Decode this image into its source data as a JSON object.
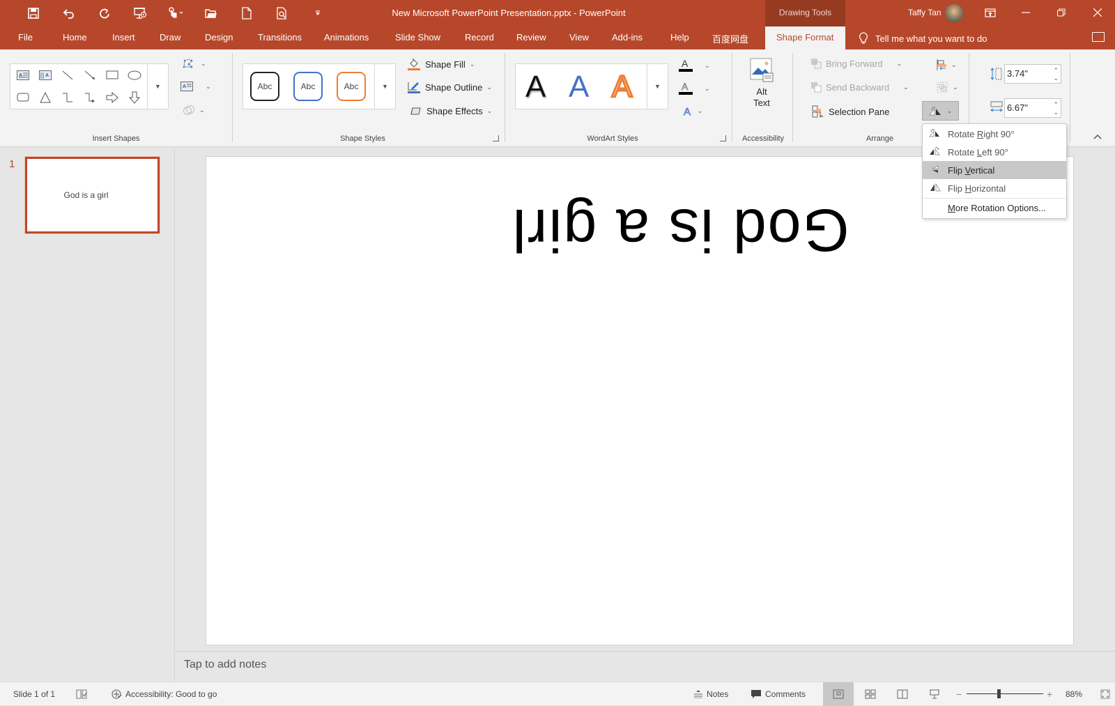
{
  "window": {
    "title": "New Microsoft PowerPoint Presentation.pptx  -  PowerPoint",
    "contextual_group": "Drawing Tools",
    "user_name": "Taffy Tan",
    "brand_color": "#b7472a"
  },
  "qat": [
    {
      "name": "save-icon",
      "glyph": "💾"
    },
    {
      "name": "undo-icon",
      "glyph": "↶"
    },
    {
      "name": "redo-icon",
      "glyph": "↻"
    },
    {
      "name": "present-from-beginning-icon",
      "glyph": "⎚"
    },
    {
      "name": "touch-mode-icon",
      "glyph": "☝"
    },
    {
      "name": "open-icon",
      "glyph": "📂"
    },
    {
      "name": "new-icon",
      "glyph": "🗋"
    },
    {
      "name": "print-preview-icon",
      "glyph": "🔍"
    },
    {
      "name": "customize-qat-icon",
      "glyph": "▾"
    }
  ],
  "tabs": [
    "File",
    "Home",
    "Insert",
    "Draw",
    "Design",
    "Transitions",
    "Animations",
    "Slide Show",
    "Record",
    "Review",
    "View",
    "Add-ins",
    "Help",
    "百度网盘",
    "Shape Format"
  ],
  "active_tab": "Shape Format",
  "tell_me": "Tell me what you want to do",
  "ribbon": {
    "groups": {
      "insert_shapes": "Insert Shapes",
      "shape_styles": "Shape Styles",
      "wordart_styles": "WordArt Styles",
      "accessibility": "Accessibility",
      "arrange": "Arrange"
    },
    "shape_style_presets": [
      "Abc",
      "Abc",
      "Abc"
    ],
    "wordart_presets": [
      "A",
      "A",
      "A"
    ],
    "shape_fill": "Shape Fill",
    "shape_outline": "Shape Outline",
    "shape_effects": "Shape Effects",
    "alt_text_line1": "Alt",
    "alt_text_line2": "Text",
    "bring_forward": "Bring Forward",
    "send_backward": "Send Backward",
    "selection_pane": "Selection Pane",
    "height_value": "3.74\"",
    "width_value": "6.67\""
  },
  "rotate_menu": {
    "items": [
      {
        "pre": "Rotate ",
        "key": "R",
        "post": "ight 90°"
      },
      {
        "pre": "Rotate ",
        "key": "L",
        "post": "eft 90°"
      },
      {
        "pre": "Flip ",
        "key": "V",
        "post": "ertical"
      },
      {
        "pre": "Flip ",
        "key": "H",
        "post": "orizontal"
      },
      {
        "pre": "",
        "key": "M",
        "post": "ore Rotation Options..."
      }
    ],
    "highlighted": "Flip Vertical"
  },
  "slides": [
    {
      "number": "1",
      "thumb_text": "God is a girl"
    }
  ],
  "slide": {
    "text": "God is a girl",
    "text_transform": "flipped-vertical"
  },
  "notes_placeholder": "Tap to add notes",
  "status": {
    "slide_counter": "Slide 1 of 1",
    "accessibility": "Accessibility: Good to go",
    "notes": "Notes",
    "comments": "Comments",
    "zoom_percent": "88%",
    "zoom_level": 88
  }
}
